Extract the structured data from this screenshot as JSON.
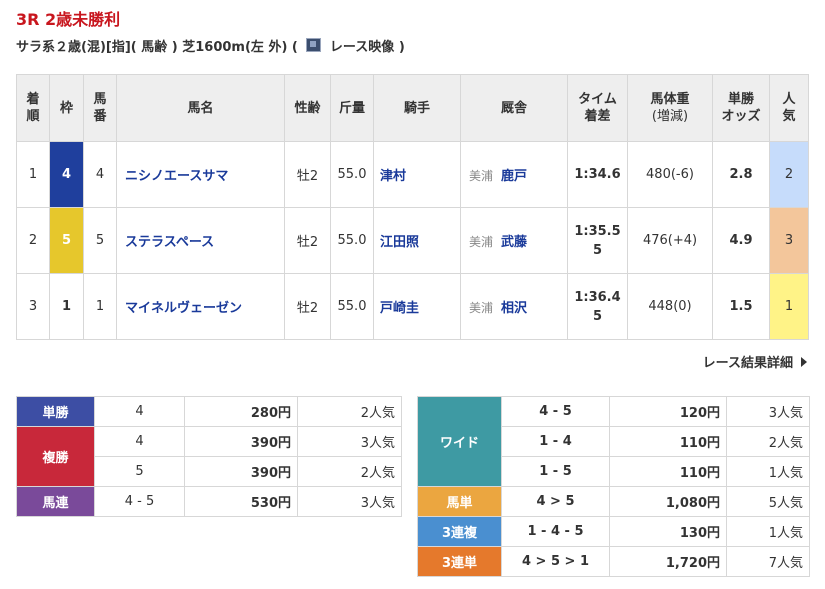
{
  "race": {
    "title": "3R 2歳未勝利",
    "info_prefix": "サラ系２歳(混)[指](",
    "info_mid": "馬齢 ) 芝1600m(左 外) (",
    "video_label": "レース映像",
    "info_suffix": ")"
  },
  "result_headers": {
    "chakujun": [
      "着",
      "順"
    ],
    "waku": "枠",
    "umaban": [
      "馬",
      "番"
    ],
    "horse": "馬名",
    "sexage": "性齢",
    "weight": "斤量",
    "jockey": "騎手",
    "stable": "厩舎",
    "time": [
      "タイム",
      "着差"
    ],
    "bodyweight": [
      "馬体重",
      "(増減)"
    ],
    "odds": [
      "単勝",
      "オッズ"
    ],
    "pop": [
      "人",
      "気"
    ]
  },
  "results": [
    {
      "rank": "1",
      "waku": "4",
      "umaban": "4",
      "horse": "ニシノエースサマ",
      "sexage": "牡2",
      "weight": "55.0",
      "jockey": "津村",
      "region": "美浦",
      "trainer": "鹿戸",
      "time": "1:34.6",
      "margin": "",
      "bodyweight": "480(-6)",
      "odds": "2.8",
      "pop": "2"
    },
    {
      "rank": "2",
      "waku": "5",
      "umaban": "5",
      "horse": "ステラスペース",
      "sexage": "牡2",
      "weight": "55.0",
      "jockey": "江田照",
      "region": "美浦",
      "trainer": "武藤",
      "time": "1:35.5",
      "margin": "5",
      "bodyweight": "476(+4)",
      "odds": "4.9",
      "pop": "3"
    },
    {
      "rank": "3",
      "waku": "1",
      "umaban": "1",
      "horse": "マイネルヴェーゼン",
      "sexage": "牡2",
      "weight": "55.0",
      "jockey": "戸崎圭",
      "region": "美浦",
      "trainer": "相沢",
      "time": "1:36.4",
      "margin": "5",
      "bodyweight": "448(0)",
      "odds": "1.5",
      "pop": "1"
    }
  ],
  "detail_link": "レース結果詳細",
  "payout_left": {
    "tansho": {
      "label": "単勝",
      "combo": "4",
      "money": "280円",
      "pop": "2人気"
    },
    "fukusho": {
      "label": "複勝",
      "rows": [
        {
          "combo": "4",
          "money": "390円",
          "pop": "3人気"
        },
        {
          "combo": "5",
          "money": "390円",
          "pop": "2人気"
        }
      ]
    },
    "umaren": {
      "label": "馬連",
      "combo": "4 - 5",
      "money": "530円",
      "pop": "3人気"
    }
  },
  "payout_right": {
    "wide": {
      "label": "ワイド",
      "rows": [
        {
          "combo": "4 - 5",
          "money": "120円",
          "pop": "3人気"
        },
        {
          "combo": "1 - 4",
          "money": "110円",
          "pop": "2人気"
        },
        {
          "combo": "1 - 5",
          "money": "110円",
          "pop": "1人気"
        }
      ]
    },
    "umatan": {
      "label": "馬単",
      "combo": "4 > 5",
      "money": "1,080円",
      "pop": "5人気"
    },
    "sanrenpuku": {
      "label": "3連複",
      "combo": "1 - 4 - 5",
      "money": "130円",
      "pop": "1人気"
    },
    "sanrentan": {
      "label": "3連単",
      "combo": "4 > 5 > 1",
      "money": "1,720円",
      "pop": "7人気"
    }
  }
}
